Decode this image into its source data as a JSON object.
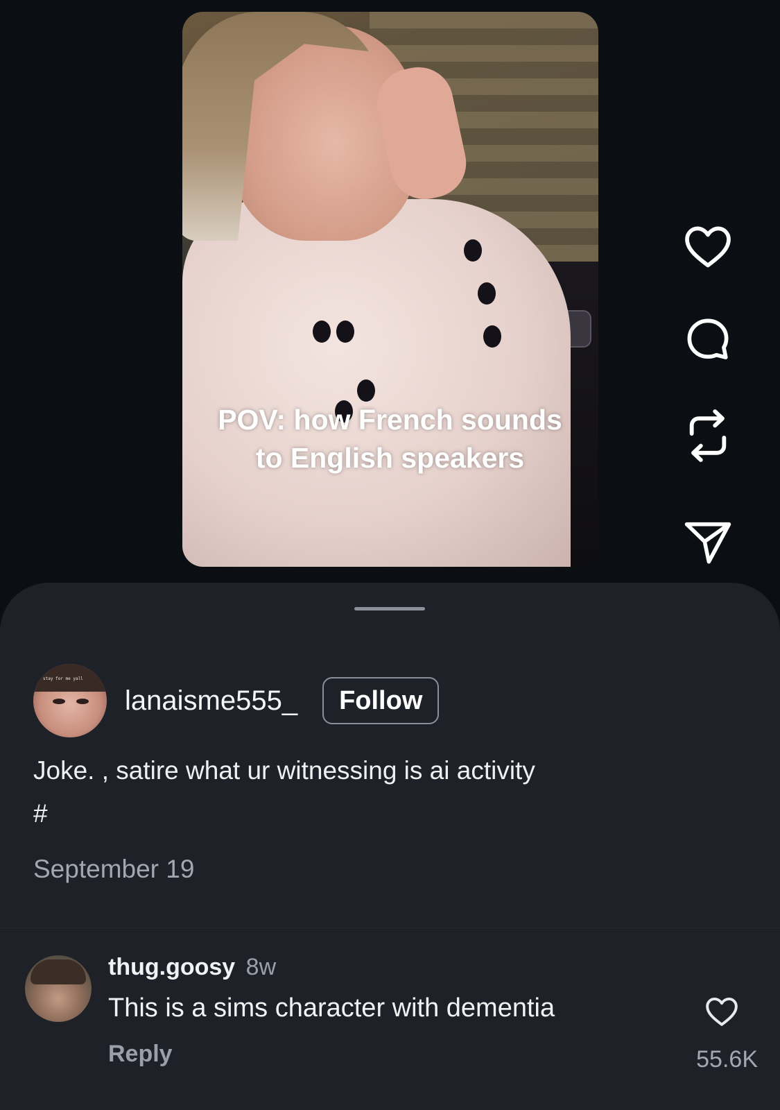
{
  "video": {
    "caption_overlay": "POV: how French sounds\nto English speakers"
  },
  "actions": {
    "like_icon": "heart-icon",
    "comment_icon": "comment-bubble-icon",
    "repost_icon": "repost-icon",
    "share_icon": "send-icon"
  },
  "post": {
    "author": "lanaisme555_",
    "follow_label": "Follow",
    "avatar_text": "stay for me yall",
    "caption_line1": "Joke. , satire what ur witnessing is ai activity",
    "caption_line2": "#",
    "date": "September 19"
  },
  "comment": {
    "username": "thug.goosy",
    "time": "8w",
    "text": "This is a sims character with dementia",
    "reply_label": "Reply",
    "like_count": "55.6K"
  },
  "colors": {
    "background": "#0b0e13",
    "sheet": "#1e2127",
    "muted_text": "#a3a8b0"
  }
}
